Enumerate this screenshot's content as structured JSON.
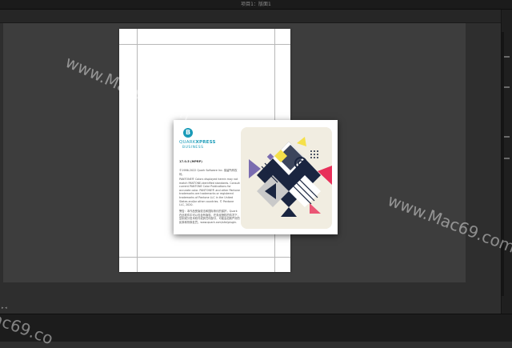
{
  "window": {
    "title": "项目1：版面1"
  },
  "splash": {
    "brand_prefix": "QUARK",
    "brand_name": "XPRESS",
    "brand_sub": "BUSINESS",
    "version": "17.0.5 (MPRP)",
    "copyright": "©1986-2022 Quark Software Inc. 保留所有权利。",
    "pantone_text": "PANTONE® Colors displayed herein may not match PANTONE-identified standards. Consult current PANTONE Color Publications for accurate color. PANTONE® and other Pantone trademarks are trademarks or registered trademarks of Pantone LLC in the United States and/or other countries. © Pantone LLC, 2020.",
    "cn_text": "警告：本作品受版权法和国际条约的保护。Quark 在此软件中可以包含有版权。在未经授权的情况下，复制或分发本软件或其任何部分，可能会招致严厉的民事和刑事处罚。www.quark.com/site/plugin."
  },
  "watermarks": [
    "www.Mac69.com",
    "www.Mac69.com",
    "ac69.co"
  ],
  "colors": {
    "accent_teal": "#1a9bb8",
    "art_pink": "#e8305a",
    "art_yellow": "#f5e04a",
    "art_purple": "#7a6cb0",
    "art_navy": "#1a2540",
    "art_bg": "#f1ede1"
  }
}
